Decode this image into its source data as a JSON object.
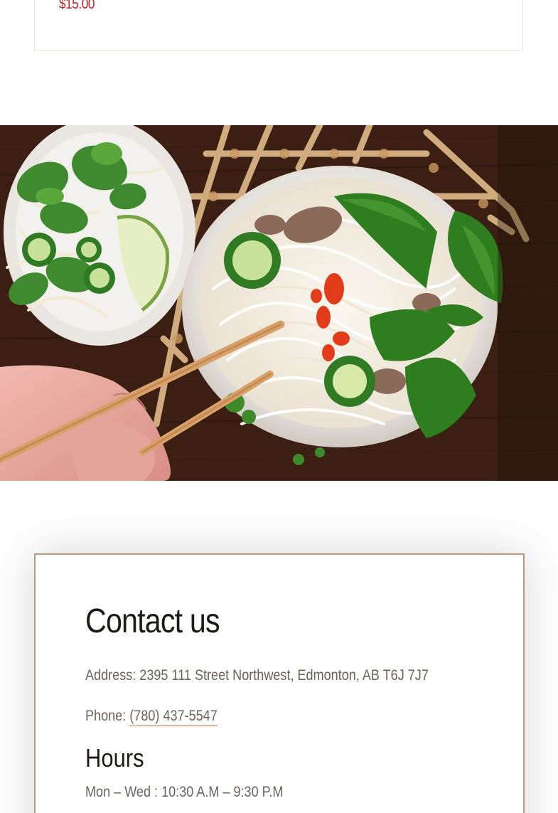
{
  "product": {
    "price": "$15.00"
  },
  "hero": {
    "image_subject": "bowl of pho with chopsticks, basil, jalapeno and lime"
  },
  "contact": {
    "title": "Contact us",
    "address_label": "Address:",
    "address_value": "2395 111 Street Northwest, Edmonton, AB T6J 7J7",
    "phone_label": "Phone:",
    "phone_value": "(780) 437-5547",
    "hours_title": "Hours",
    "hours": [
      {
        "days": "Mon – Wed",
        "time": "10:30 A.M – 9:30 P.M"
      }
    ]
  },
  "colors": {
    "price": "#c0202a",
    "card_border": "#b79a83",
    "link_underline": "#c47a5a",
    "heading": "#1f1a17",
    "body_text": "#6b625c"
  }
}
